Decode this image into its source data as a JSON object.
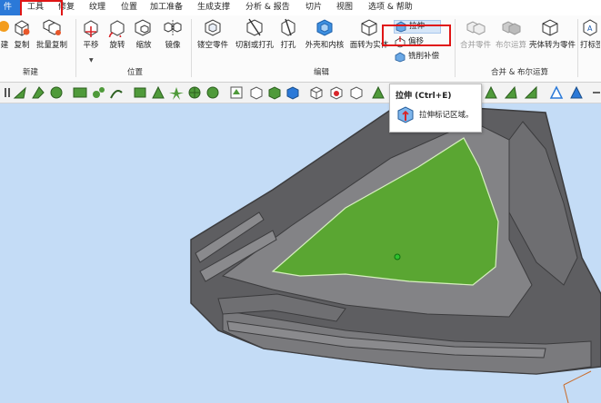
{
  "menu": {
    "tabs": [
      "件",
      "工具",
      "修复",
      "纹理",
      "位置",
      "加工准备",
      "生成支撑",
      "分析 & 报告",
      "切片",
      "视图",
      "选项 & 帮助"
    ],
    "active": "工具"
  },
  "ribbon": {
    "groups": {
      "new": "新建",
      "position": "位置",
      "edit": "编辑",
      "boolean": "合并 & 布尔运算"
    },
    "buttons": {
      "partial_left": "建",
      "copy": "复制",
      "batch_copy": "批量复制",
      "translate": "平移",
      "rotate": "旋转",
      "scale": "缩放",
      "mirror": "镜像",
      "hollow": "镂空零件",
      "cut_punch": "切割或打孔",
      "punch": "打孔",
      "shell": "外壳和内核",
      "surface_to_solid": "面转为实体",
      "extrude": "拉伸",
      "offset": "偏移",
      "trim_fill": "铣削补偿",
      "merge_parts": "合并零件",
      "boolean_op": "布尔运算",
      "shell_to_part": "壳体转为零件",
      "print_label": "打标签"
    }
  },
  "tooltip": {
    "title": "拉伸 (Ctrl+E)",
    "description": "拉伸标记区域。"
  },
  "colors": {
    "highlight_box": "#e01515",
    "selected_region": "#5aa632",
    "viewport_bg": "#c4dcf6",
    "model_gray": "#6a6a6c",
    "file_tab": "#2b79d8"
  }
}
